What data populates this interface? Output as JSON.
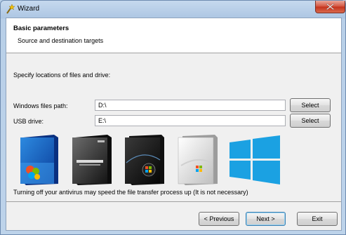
{
  "window": {
    "title": "Wizard",
    "icon": "wand-icon",
    "close_icon": "close-icon"
  },
  "header": {
    "title": "Basic parameters",
    "subtitle": "Source and destination targets"
  },
  "main": {
    "instruction": "Specify locations of files and drive:",
    "windows_path": {
      "label": "Windows files path:",
      "value": "D:\\"
    },
    "usb_drive": {
      "label": "USB drive:",
      "value": "E:\\"
    },
    "select_label": "Select",
    "product_images": [
      "windows-xp-box-icon",
      "windows-server-2003-box-icon",
      "windows-vista-box-icon",
      "windows-7-box-icon",
      "windows-8-logo-icon"
    ],
    "note": "Turning off your antivirus may speed the file transfer process up (It is not necessary)"
  },
  "footer": {
    "previous_label": "< Previous",
    "next_label": "Next >",
    "exit_label": "Exit"
  },
  "colors": {
    "win8_blue": "#1ba1e2",
    "accent_border": "#3c7fb1"
  }
}
